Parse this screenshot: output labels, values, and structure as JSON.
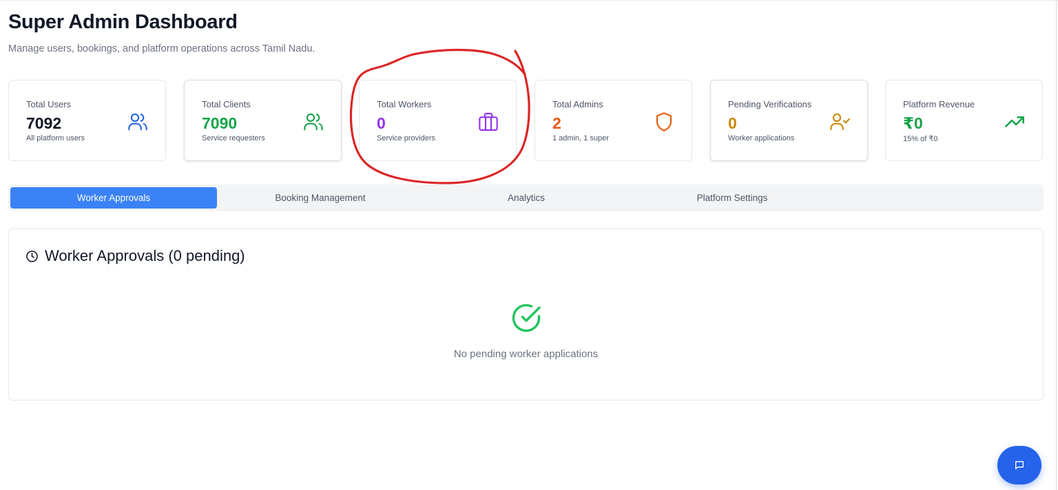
{
  "header": {
    "title": "Super Admin Dashboard",
    "subtitle": "Manage users, bookings, and platform operations across Tamil Nadu."
  },
  "stats": [
    {
      "label": "Total Users",
      "value": "7092",
      "sub": "All platform users",
      "icon": "users-icon",
      "color": "#2563eb"
    },
    {
      "label": "Total Clients",
      "value": "7090",
      "sub": "Service requesters",
      "icon": "users-icon",
      "color": "#16a34a"
    },
    {
      "label": "Total Workers",
      "value": "0",
      "sub": "Service providers",
      "icon": "briefcase-icon",
      "color": "#9333ea"
    },
    {
      "label": "Total Admins",
      "value": "2",
      "sub": "1 admin, 1 super",
      "icon": "shield-icon",
      "color": "#ea580c"
    },
    {
      "label": "Pending Verifications",
      "value": "0",
      "sub": "Worker applications",
      "icon": "user-check-icon",
      "color": "#ca8a04"
    },
    {
      "label": "Platform Revenue",
      "value": "₹0",
      "sub": "15% of ₹0",
      "icon": "trending-up-icon",
      "color": "#16a34a"
    }
  ],
  "tabs": [
    {
      "label": "Worker Approvals",
      "active": true
    },
    {
      "label": "Booking Management",
      "active": false
    },
    {
      "label": "Analytics",
      "active": false
    },
    {
      "label": "Platform Settings",
      "active": false
    }
  ],
  "panel": {
    "title": "Worker Approvals (0 pending)",
    "title_icon": "clock-icon",
    "empty_icon": "check-circle-icon",
    "empty_text": "No pending worker applications"
  },
  "chat": {
    "icon": "chat-icon"
  },
  "colors": {
    "accent": "#3b82f6",
    "fab": "#2563eb",
    "annotation": "#dc2626",
    "success": "#22c55e"
  }
}
